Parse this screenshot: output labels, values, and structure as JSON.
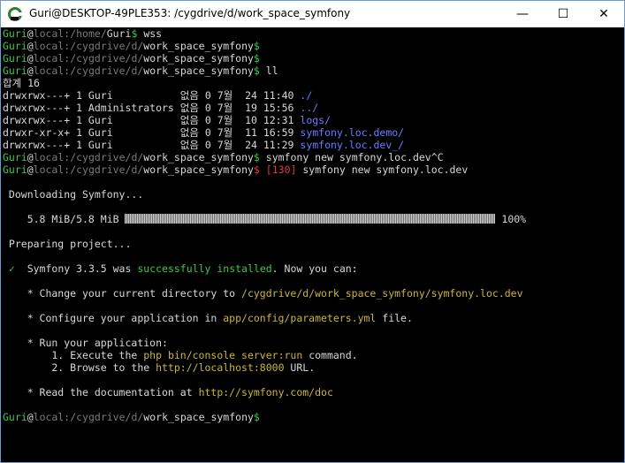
{
  "window": {
    "title": "Guri@DESKTOP-49PLE353: /cygdrive/d/work_space_symfony",
    "minimize_glyph": "—",
    "maximize_glyph": "☐",
    "close_glyph": "✕",
    "app_icon": "cygwin-terminal-icon"
  },
  "prompt": {
    "user": "Guri",
    "at": "@",
    "host": "local",
    "colon": ":",
    "home_path_prefix": "/home/",
    "home_path_user": "Guri",
    "ws_path_prefix": "/cygdrive/d/",
    "ws_path_dir": "work_space_symfony",
    "dollar": "$"
  },
  "commands": {
    "wss": " wss",
    "ll": " ll",
    "cancelled": " symfony new symfony.loc.dev^C",
    "exit_code": "[130]",
    "new": " symfony new symfony.loc.dev"
  },
  "listing": {
    "total": "합계 16",
    "rows": [
      {
        "meta": "drwxrwx---+ 1 Guri           없음 0 7월  24 11:40 ",
        "name": "./"
      },
      {
        "meta": "drwxrwx---+ 1 Administrators 없음 0 7월  19 15:56 ",
        "name": "../"
      },
      {
        "meta": "drwxrwx---+ 1 Guri           없음 0 7월  10 12:31 ",
        "name": "logs/"
      },
      {
        "meta": "drwxr-xr-x+ 1 Guri           없음 0 7월  11 16:59 ",
        "name": "symfony.loc.demo/"
      },
      {
        "meta": "drwxrwx---+ 1 Guri           없음 0 7월  24 11:29 ",
        "name": "symfony.loc.dev_/"
      }
    ]
  },
  "install": {
    "downloading": " Downloading Symfony...",
    "size": "    5.8 MiB/5.8 MiB ",
    "progress_pct": 100,
    "progress_label": " 100%",
    "preparing": " Preparing project...",
    "checkmark": " ✓",
    "symfony_prefix": "  Symfony 3.3.5 was ",
    "success_text": "successfully installed",
    "symfony_suffix": ". Now you can:",
    "step1_prefix": "    * Change your current directory to ",
    "step1_path": "/cygdrive/d/work_space_symfony/symfony.loc.dev",
    "step2_prefix": "    * Configure your application in ",
    "step2_path": "app/config/parameters.yml",
    "step2_suffix": " file.",
    "step3_title": "    * Run your application:",
    "step3_1_prefix": "        1. Execute the ",
    "step3_1_cmd": "php bin/console server:run",
    "step3_1_suffix": " command.",
    "step3_2_prefix": "        2. Browse to the ",
    "step3_2_url": "http://localhost:8000",
    "step3_2_suffix": " URL.",
    "step4_prefix": "    * Read the documentation at ",
    "step4_url": "http://symfony.com/doc"
  }
}
